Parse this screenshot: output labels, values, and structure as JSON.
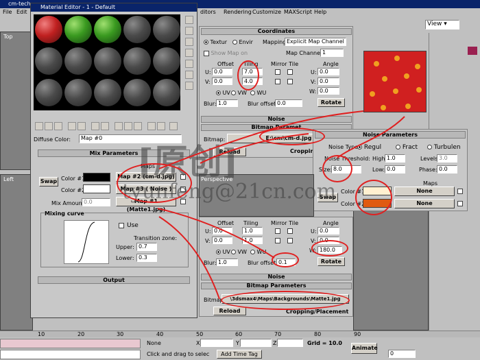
{
  "main_window": {
    "title_fragment": "cm-tech",
    "menu": [
      "File",
      "Edit"
    ],
    "menu_right": [
      "ditors",
      "Rendering",
      "Customize",
      "MAXScript",
      "Help"
    ],
    "viewport_labels": {
      "top": "Top",
      "left": "Left",
      "perspective": "Perspective"
    },
    "view_dropdown": "View",
    "timeline_ticks": [
      "10",
      "20",
      "30",
      "40",
      "50",
      "60",
      "70",
      "80",
      "90"
    ],
    "status": {
      "selection": "None",
      "x_label": "X",
      "y_label": "Y",
      "z_label": "Z",
      "grid": "Grid = 10.0",
      "hint": "Click and drag to selec",
      "add_time_tag": "Add Time Tag",
      "animate": "Animate",
      "frame": "0"
    }
  },
  "material_editor": {
    "title": "Material Editor - 1 - Default",
    "diffuse_label": "Diffuse Color:",
    "map_name": "Map #0",
    "mix_rollout": "Mix Parameters",
    "maps_label": "Maps",
    "swap": "Swap",
    "color1_label": "Color #1",
    "color2_label": "Color #2",
    "map1": "Map #2 (cm-d.jpg)",
    "map2": "Map #3  ( Noise )",
    "mix_amount_label": "Mix Amount:",
    "mix_amount": "0.0",
    "mix_map": "Map #1 (Matte1.jpg)",
    "mixing_curve_label": "Mixing curve",
    "use_label": "Use",
    "transition_label": "Transition zone:",
    "upper_label": "Upper:",
    "upper": "0.7",
    "lower_label": "Lower:",
    "lower": "0.3",
    "output_rollout": "Output"
  },
  "coords_panel_top": {
    "rollout": "Coordinates",
    "texture": "Textur",
    "environ": "Envir",
    "mapping_label": "Mapping:",
    "mapping": "Explicit Map Channel",
    "show_map_on": "Show Map on",
    "map_channel_label": "Map Channel:",
    "map_channel": "1",
    "offset_label": "Offset",
    "tiling_label": "Tiling",
    "mirror_tile_label": "Mirror Tile",
    "angle_label": "Angle",
    "u_label": "U:",
    "v_label": "V:",
    "w_label": "W:",
    "u_offset": "0.0",
    "v_offset": "0.0",
    "u_tiling": "7.0",
    "v_tiling": "4.0",
    "u_angle": "0.0",
    "v_angle": "0.0",
    "w_angle": "0.0",
    "uv": "UV",
    "vw": "VW",
    "wu": "WU",
    "blur_label": "Blur:",
    "blur": "1.0",
    "blur_offset_label": "Blur offset:",
    "blur_offset": "0.0",
    "rotate": "Rotate",
    "noise_rollout": "Noise",
    "bitmap_rollout": "Bitmap Paramet",
    "bitmap_label": "Bitmap:",
    "bitmap_path": "E:\\cm\\cm-d.jpg",
    "reload": "Reload",
    "cropping": "Cropping/Placem"
  },
  "noise_panel": {
    "rollout": "Noise Parameters",
    "noise_type_label": "Noise Type:",
    "regular": "Regul",
    "fractal": "Fract",
    "turbulence": "Turbulen",
    "noise_threshold_label": "Noise Threshold:",
    "high_label": "High:",
    "high": "1.0",
    "levels_label": "Levels:",
    "levels": "3.0",
    "size_label": "Size:",
    "size": "8.0",
    "low_label": "Low:",
    "low": "0.0",
    "phase_label": "Phase:",
    "phase": "0.0",
    "maps_label": "Maps",
    "swap": "Swap",
    "color1_label": "Color #1",
    "color2_label": "Color #2",
    "map1": "None",
    "map2": "None",
    "color1": "#fff0d0",
    "color2": "#e05a10"
  },
  "coords_panel_bottom": {
    "offset_label": "Offset",
    "tiling_label": "Tiling",
    "mirror_tile_label": "Mirror Tile",
    "angle_label": "Angle",
    "u_label": "U:",
    "v_label": "V:",
    "w_label": "W:",
    "u_offset": "0.0",
    "v_offset": "0.0",
    "u_tiling": "1.0",
    "v_tiling": "1.0",
    "u_angle": "0.0",
    "v_angle": "0.0",
    "w_angle": "180.0",
    "uv": "UV",
    "vw": "VW",
    "wu": "WU",
    "blur_label": "Blur:",
    "blur": "1.0",
    "blur_offset_label": "Blur offset:",
    "blur_offset": "0.1",
    "rotate": "Rotate",
    "noise_rollout": "Noise",
    "bitmap_rollout": "Bitmap Parameters",
    "bitmap_label": "Bitmap:",
    "bitmap_path": "\\3dsmax4\\Maps\\Backgrounds\\Matte1.jpg",
    "reload": "Reload",
    "cropping": "Cropping/Placement"
  },
  "watermark": {
    "cn": "[原创]",
    "en": "tyunfeng@21cn.com"
  },
  "colors": {
    "annotation": "#e02020",
    "title_active": "#0a246a"
  }
}
